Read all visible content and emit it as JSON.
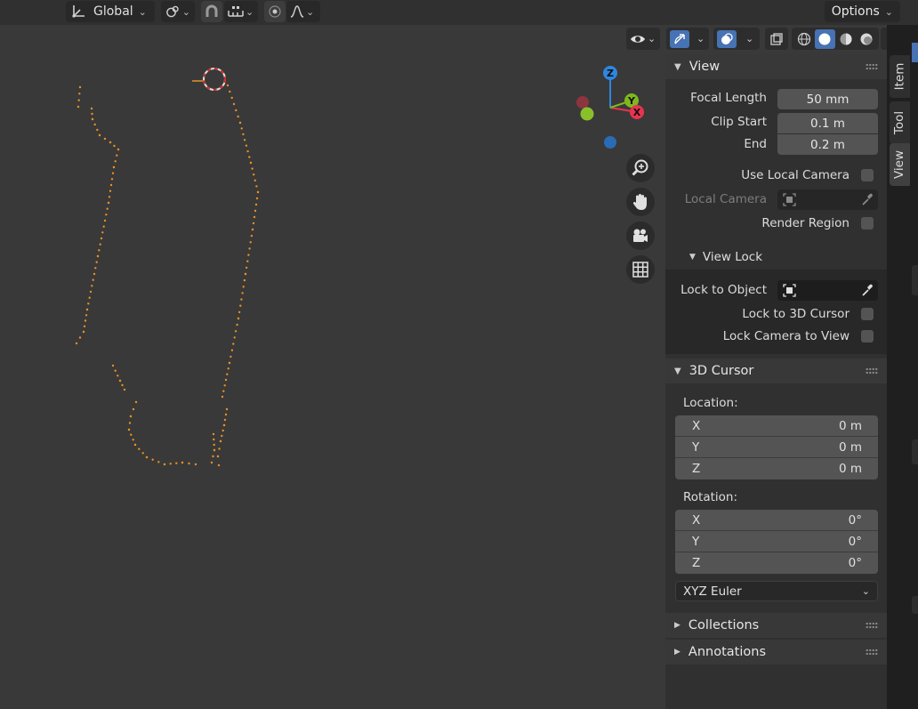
{
  "topbar": {
    "orientation_label": "Global",
    "options_label": "Options"
  },
  "gizmo": {
    "z_label": "Z",
    "y_label": "Y",
    "x_label": "X"
  },
  "tabs": {
    "item": "Item",
    "tool": "Tool",
    "view": "View"
  },
  "view_panel": {
    "title": "View",
    "focal_length_label": "Focal Length",
    "focal_length_value": "50 mm",
    "clip_start_label": "Clip Start",
    "clip_start_value": "0.1 m",
    "clip_end_label": "End",
    "clip_end_value": "0.2 m",
    "use_local_camera_label": "Use Local Camera",
    "local_camera_label": "Local Camera",
    "render_region_label": "Render Region",
    "view_lock": {
      "title": "View Lock",
      "lock_to_object_label": "Lock to Object",
      "lock_to_3d_cursor_label": "Lock to 3D Cursor",
      "lock_camera_to_view_label": "Lock Camera to View"
    }
  },
  "cursor_panel": {
    "title": "3D Cursor",
    "location_label": "Location:",
    "location": [
      {
        "axis": "X",
        "value": "0 m"
      },
      {
        "axis": "Y",
        "value": "0 m"
      },
      {
        "axis": "Z",
        "value": "0 m"
      }
    ],
    "rotation_label": "Rotation:",
    "rotation": [
      {
        "axis": "X",
        "value": "0°"
      },
      {
        "axis": "Y",
        "value": "0°"
      },
      {
        "axis": "Z",
        "value": "0°"
      }
    ],
    "rotation_mode": "XYZ Euler"
  },
  "collections_panel": {
    "title": "Collections"
  },
  "annotations_panel": {
    "title": "Annotations"
  },
  "colors": {
    "accent": "#4772b3",
    "curve_points": "#e8902a",
    "axis_x": "#e8344e",
    "axis_y": "#7fb81e",
    "axis_z": "#2f86e0"
  }
}
